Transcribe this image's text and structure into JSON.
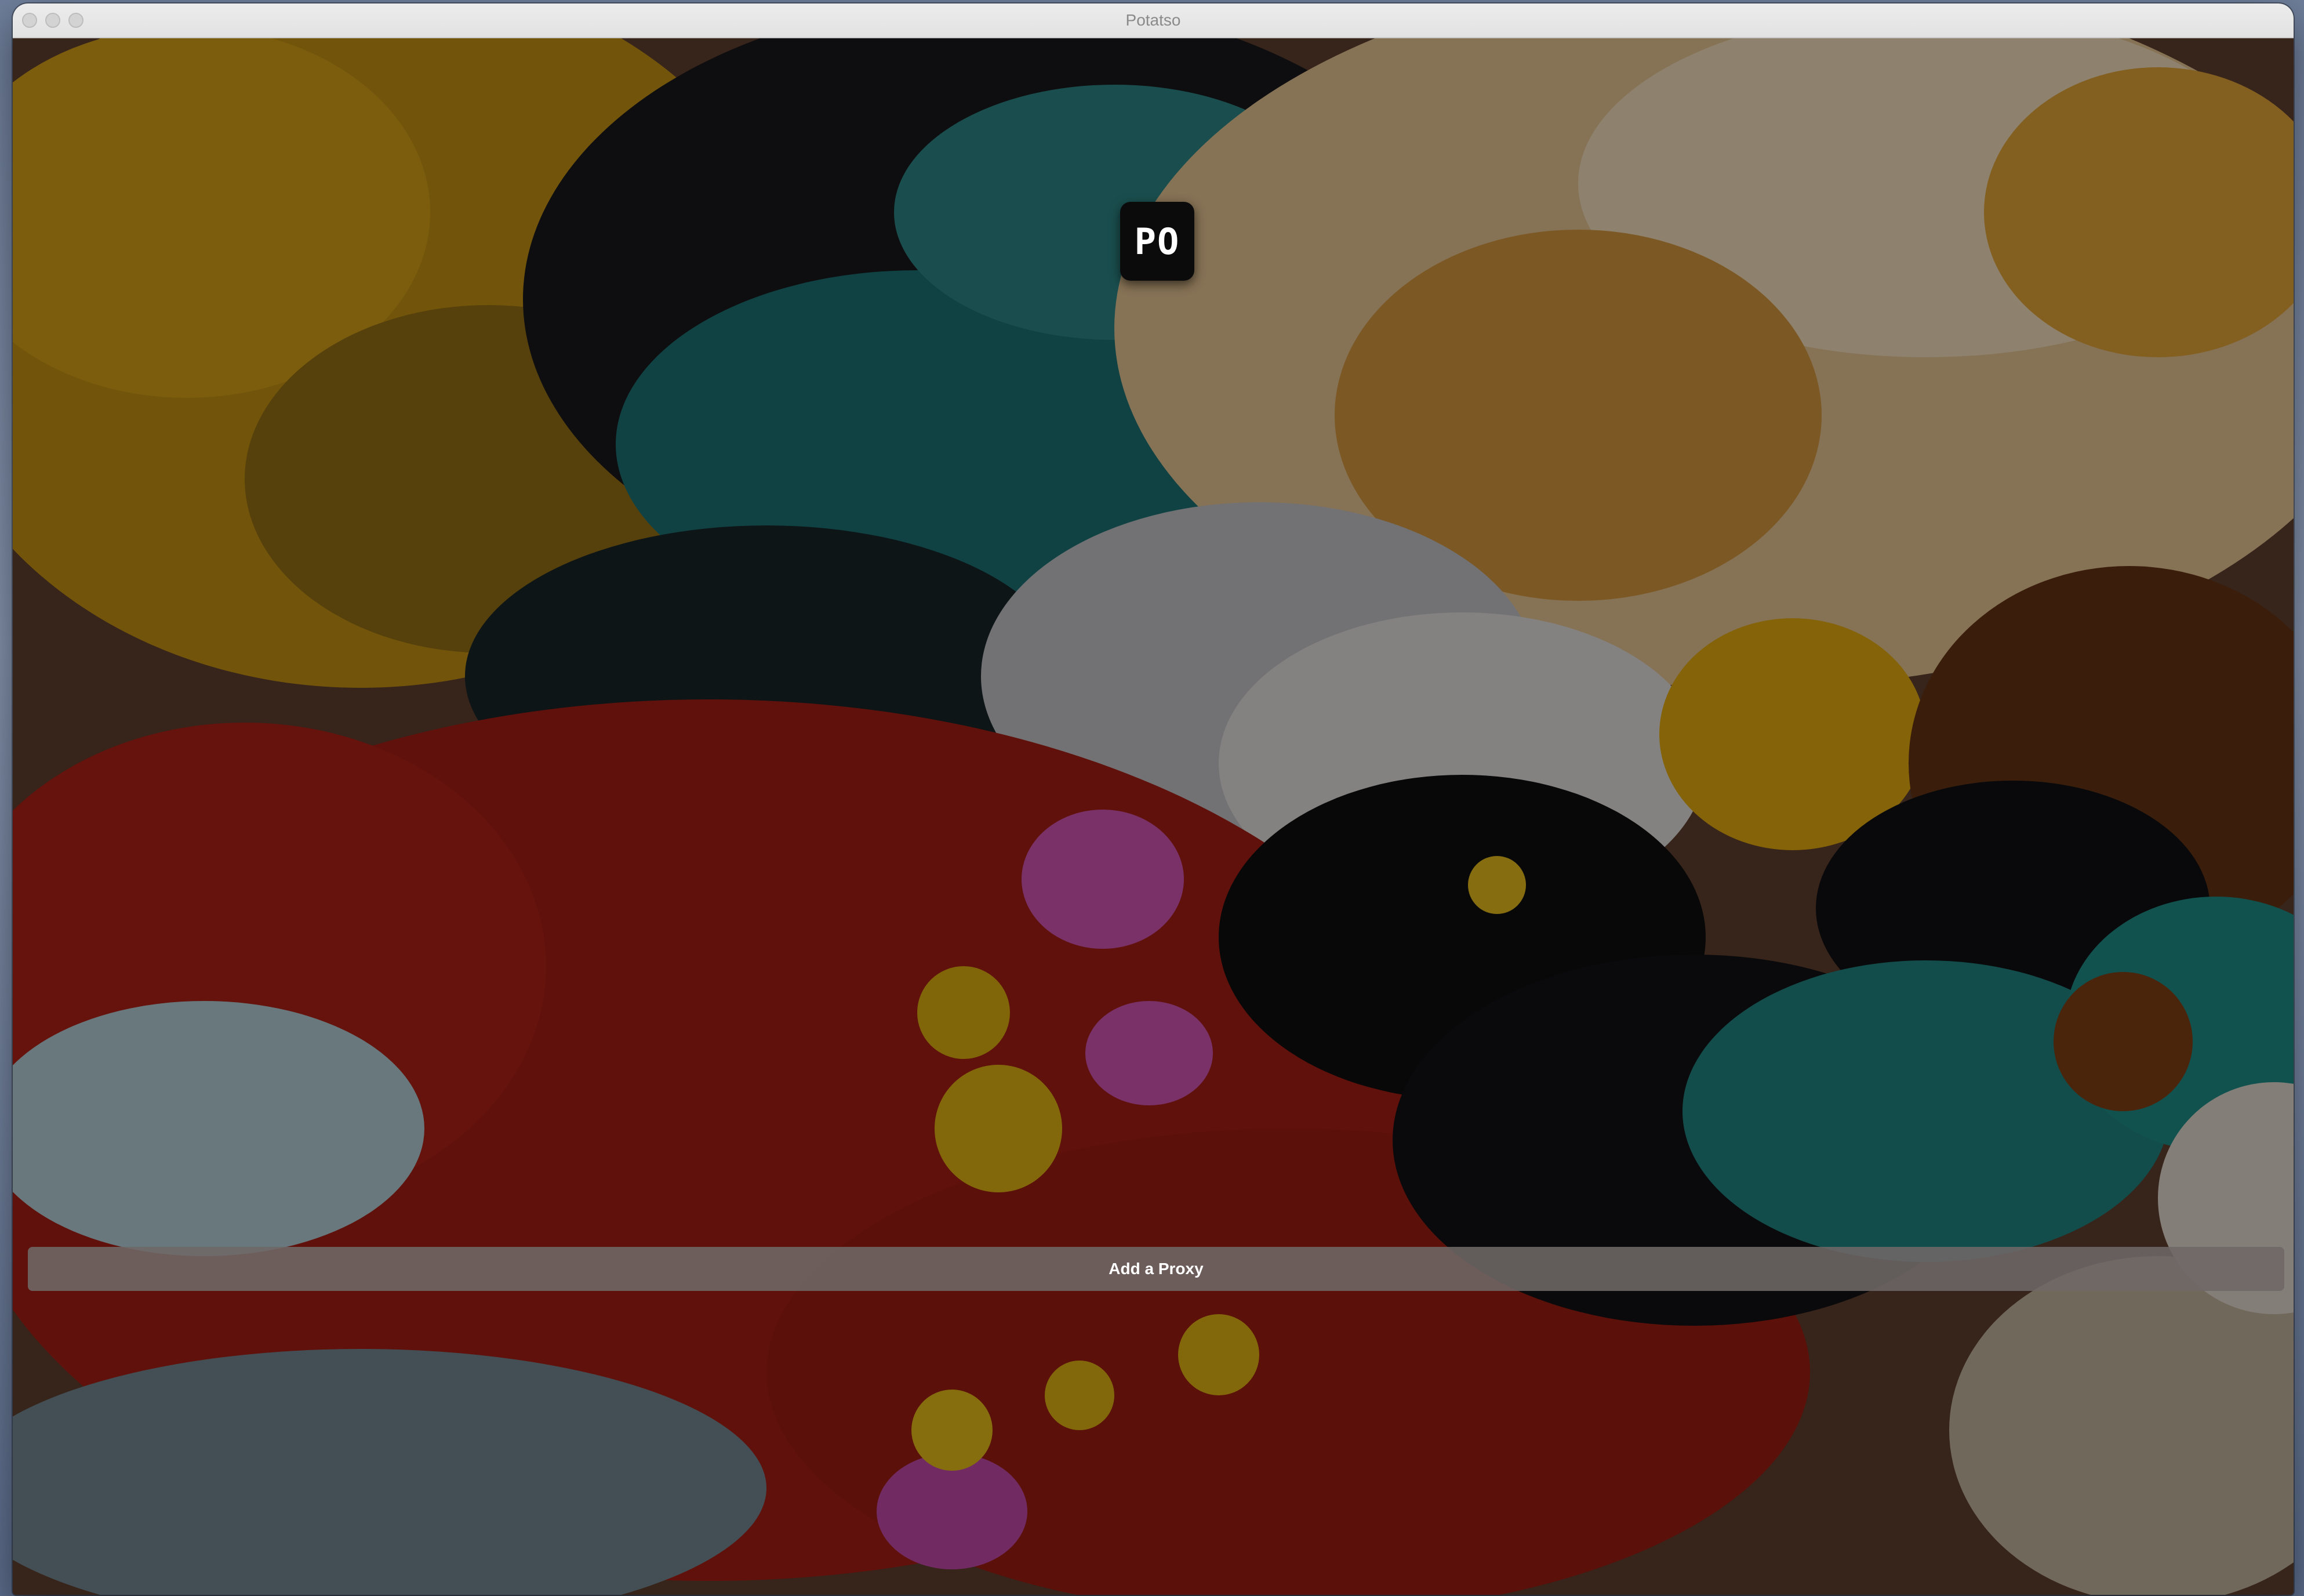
{
  "window": {
    "title": "Potatso"
  },
  "logo": {
    "text": "PO"
  },
  "actions": {
    "add_proxy_label": "Add a Proxy"
  },
  "colors": {
    "titlebar": "#e6e6e6",
    "logo_bg": "#0b0b0b",
    "button_bg": "#6e6866"
  },
  "icons": {
    "close": "close-traffic-light",
    "minimize": "minimize-traffic-light",
    "zoom": "zoom-traffic-light"
  }
}
